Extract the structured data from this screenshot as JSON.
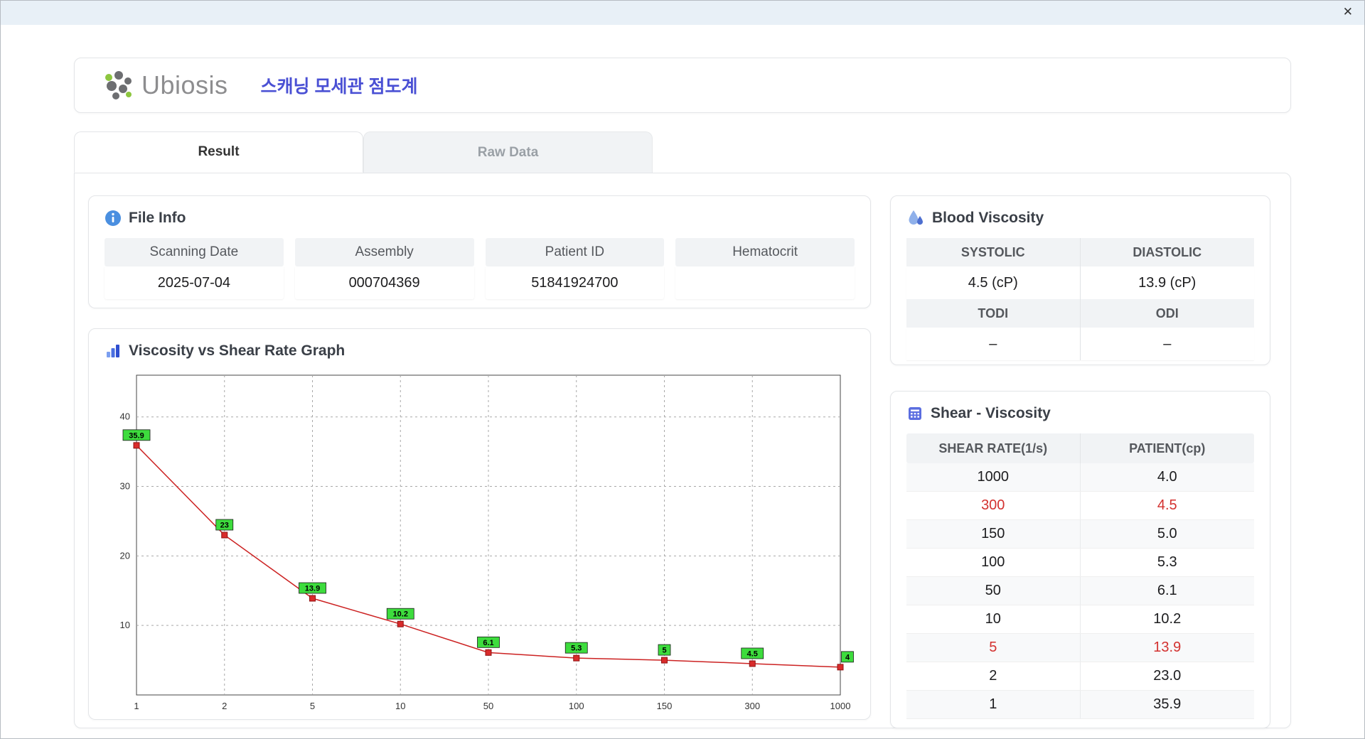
{
  "window": {
    "close_label": "✕"
  },
  "header": {
    "logo_text": "Ubiosis",
    "title": "스캐닝 모세관 점도계"
  },
  "tabs": [
    {
      "label": "Result",
      "active": true
    },
    {
      "label": "Raw Data",
      "active": false
    }
  ],
  "file_info": {
    "title": "File Info",
    "fields": [
      {
        "label": "Scanning Date",
        "value": "2025-07-04"
      },
      {
        "label": "Assembly",
        "value": "000704369"
      },
      {
        "label": "Patient ID",
        "value": "51841924700"
      },
      {
        "label": "Hematocrit",
        "value": ""
      }
    ]
  },
  "graph_section": {
    "title": "Viscosity vs Shear Rate Graph"
  },
  "blood_viscosity": {
    "title": "Blood Viscosity",
    "rows": [
      {
        "labels": [
          "SYSTOLIC",
          "DIASTOLIC"
        ],
        "values": [
          "4.5 (cP)",
          "13.9 (cP)"
        ]
      },
      {
        "labels": [
          "TODI",
          "ODI"
        ],
        "values": [
          "–",
          "–"
        ]
      }
    ]
  },
  "shear_viscosity": {
    "title": "Shear - Viscosity",
    "columns": [
      "SHEAR RATE(1/s)",
      "PATIENT(cp)"
    ],
    "rows": [
      {
        "shear": "1000",
        "patient": "4.0",
        "highlight": false
      },
      {
        "shear": "300",
        "patient": "4.5",
        "highlight": true
      },
      {
        "shear": "150",
        "patient": "5.0",
        "highlight": false
      },
      {
        "shear": "100",
        "patient": "5.3",
        "highlight": false
      },
      {
        "shear": "50",
        "patient": "6.1",
        "highlight": false
      },
      {
        "shear": "10",
        "patient": "10.2",
        "highlight": false
      },
      {
        "shear": "5",
        "patient": "13.9",
        "highlight": true
      },
      {
        "shear": "2",
        "patient": "23.0",
        "highlight": false
      },
      {
        "shear": "1",
        "patient": "35.9",
        "highlight": false
      }
    ]
  },
  "chart_data": {
    "type": "line",
    "title": "Viscosity vs Shear Rate Graph",
    "x_categories": [
      1,
      2,
      5,
      10,
      50,
      100,
      150,
      300,
      1000
    ],
    "values": [
      35.9,
      23,
      13.9,
      10.2,
      6.1,
      5.3,
      5,
      4.5,
      4
    ],
    "point_labels": [
      "35.9",
      "23",
      "13.9",
      "10.2",
      "6.1",
      "5.3",
      "5",
      "4.5",
      "4"
    ],
    "y_ticks": [
      10,
      20,
      30,
      40
    ],
    "ylim": [
      0,
      46
    ],
    "xlabel": "",
    "ylabel": "",
    "grid": "dashed",
    "legend": "none",
    "line_color": "#cc2222",
    "marker_color": "#d92b2b",
    "marker_border": "#8f1212",
    "label_bg": "#3ddc3d",
    "label_border": "#1a1a1a"
  },
  "colors": {
    "accent_blue": "#4a50d4",
    "highlight_red": "#d3312f",
    "panel_label_bg": "#f1f3f5",
    "titlebar_bg": "#e8f0f7",
    "icon_blue": "#4a8fe0",
    "logo_green": "#8dc63f",
    "logo_gray": "#6d6e71"
  }
}
